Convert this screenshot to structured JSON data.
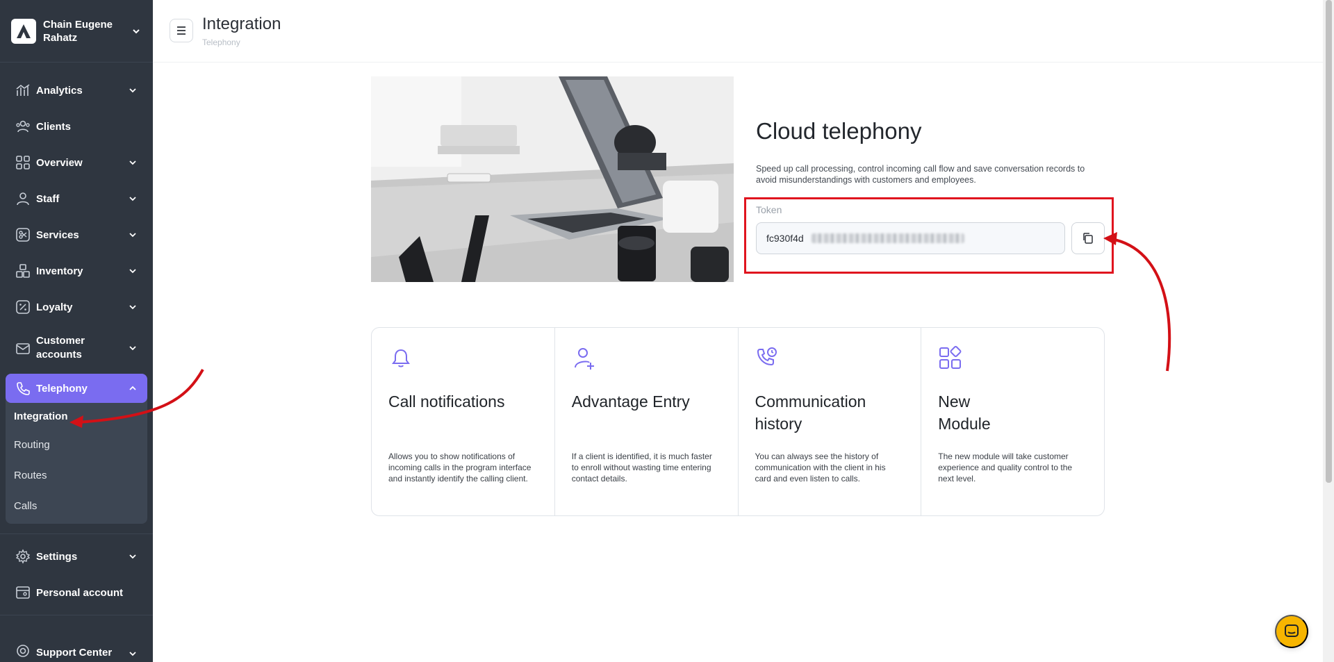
{
  "brand": {
    "name": "Chain Eugene Rahatz"
  },
  "sidebar": {
    "items": [
      {
        "label": "Analytics"
      },
      {
        "label": "Clients"
      },
      {
        "label": "Overview"
      },
      {
        "label": "Staff"
      },
      {
        "label": "Services"
      },
      {
        "label": "Inventory"
      },
      {
        "label": "Loyalty"
      },
      {
        "label": "Customer accounts"
      },
      {
        "label": "Telephony"
      },
      {
        "label": "Settings"
      },
      {
        "label": "Personal account"
      },
      {
        "label": "Support Center"
      }
    ],
    "telephony_sub": [
      {
        "label": "Integration"
      },
      {
        "label": "Routing"
      },
      {
        "label": "Routes"
      },
      {
        "label": "Calls"
      }
    ]
  },
  "header": {
    "title": "Integration",
    "breadcrumb": "Telephony"
  },
  "hero": {
    "title": "Cloud telephony",
    "description": "Speed up call processing, control incoming call flow and save conversation records to avoid misunderstandings with customers and employees.",
    "token_label": "Token",
    "token_value": "fc930f4d"
  },
  "features": [
    {
      "icon": "bell-icon",
      "title": "Call notifications",
      "description": "Allows you to show notifications of incoming calls in the program interface and instantly identify the calling client."
    },
    {
      "icon": "user-plus-icon",
      "title": "Advantage Entry",
      "description": "If a client is identified, it is much faster to enroll without wasting time entering contact details."
    },
    {
      "icon": "phone-clock-icon",
      "title": "Communication history",
      "description": "You can always see the history of communication with the client in his card and even listen to calls."
    },
    {
      "icon": "modules-icon",
      "title": "New Module",
      "description": "The new module will take customer experience and quality control to the next level."
    }
  ],
  "colors": {
    "sidebar": "#2f3640",
    "accent": "#7a6cf0",
    "highlight": "#e0141e",
    "chat": "#f7b500"
  }
}
